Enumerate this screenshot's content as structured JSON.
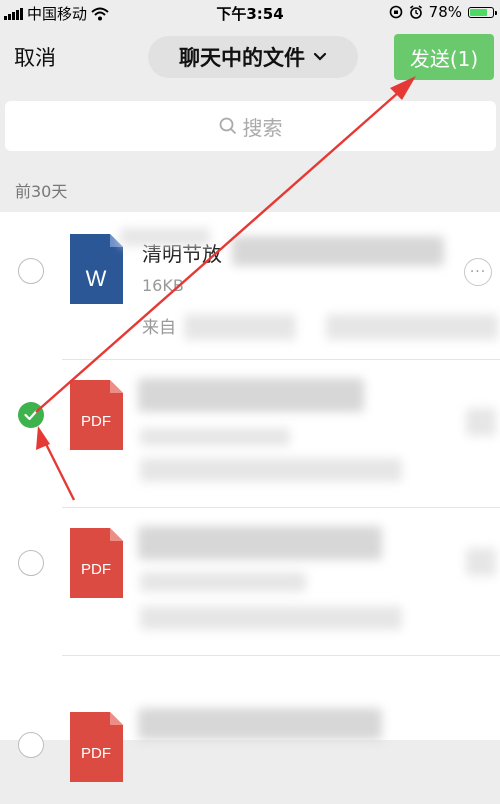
{
  "status_bar": {
    "carrier": "中国移动",
    "time": "下午3:54",
    "battery": "78%",
    "battery_level": 0.78
  },
  "nav": {
    "cancel_label": "取消",
    "title": "聊天中的文件",
    "send_label": "发送(1)"
  },
  "search": {
    "placeholder": "搜索"
  },
  "section": {
    "label": "前30天"
  },
  "files": [
    {
      "type": "W",
      "name_visible": "清明节放",
      "size": "16KB",
      "source_prefix": "来自",
      "selected": false
    },
    {
      "type": "PDF",
      "selected": true
    },
    {
      "type": "PDF",
      "selected": false
    },
    {
      "type": "PDF",
      "selected": false
    }
  ],
  "colors": {
    "send_green": "#6ac96d",
    "check_green": "#3eb34d",
    "word_blue": "#2b5797",
    "pdf_red": "#dc4b41",
    "annotation_red": "#e53935"
  }
}
